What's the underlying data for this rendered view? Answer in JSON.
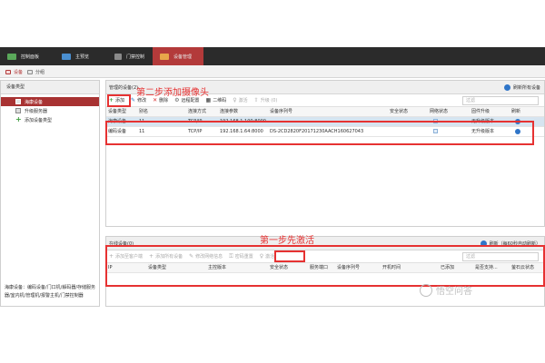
{
  "topbar": {
    "tabs": [
      {
        "label": "控制面板"
      },
      {
        "label": "主预览"
      },
      {
        "label": "门禁控制"
      },
      {
        "label": "设备管理"
      }
    ]
  },
  "subtabs": [
    {
      "label": "设备"
    },
    {
      "label": "分组"
    }
  ],
  "left": {
    "header": "设备类型",
    "items": [
      {
        "label": "海康设备"
      },
      {
        "label": "升级服务器"
      },
      {
        "label": "添加设备类型"
      }
    ],
    "description": "海康设备：编码设备/门口机/解码器/存储服务器/室内机/管理机/报警主机/门禁控制器"
  },
  "managed": {
    "header": "管理的设备(2)",
    "refresh_all": "刷新所有设备",
    "toolbar": {
      "add": "添加",
      "modify": "修改",
      "delete": "删除",
      "remote_config": "远程配置",
      "qr_code": "二维码",
      "activate": "激活",
      "upgrade": "升级 (0)"
    },
    "filter_placeholder": "过滤",
    "columns": [
      "设备类型",
      "别名",
      "连接方式",
      "连接参数",
      "设备序列号",
      "安全状态",
      "网络状态",
      "固件升级",
      "刷新"
    ],
    "rows": [
      {
        "type": "海康设备",
        "alias": "11",
        "conn": "TCP/IP",
        "param": "192.168.1.100:8000",
        "serial": "",
        "firmware": "无升级版本"
      },
      {
        "type": "编码设备",
        "alias": "11",
        "conn": "TCP/IP",
        "param": "192.168.1.64:8000",
        "serial": "DS-2CD2820F20171230AACH160627043",
        "firmware": "无升级版本"
      }
    ]
  },
  "online": {
    "header": "在线设备(0)",
    "refresh": "刷新（每60秒自动刷新）",
    "toolbar": {
      "add_client": "添加至客户端",
      "add_all": "添加所有设备",
      "modify_net": "修改网络信息",
      "reset_pwd": "密码重置",
      "activate": "激活"
    },
    "filter_placeholder": "过滤",
    "columns": [
      "IP",
      "设备类型",
      "主控版本",
      "安全状态",
      "服务端口",
      "设备序列号",
      "开机时间",
      "已添加",
      "是否支持...",
      "萤石云状态"
    ]
  },
  "annotations": {
    "step2": "第二步添加摄像头",
    "step1": "第一步先激活"
  },
  "colors": {
    "accent": "#b33a3a",
    "annotation": "#e63232",
    "link": "#2f75c8",
    "topbar": "#2b2b2b"
  },
  "watermark": "悟空问答"
}
